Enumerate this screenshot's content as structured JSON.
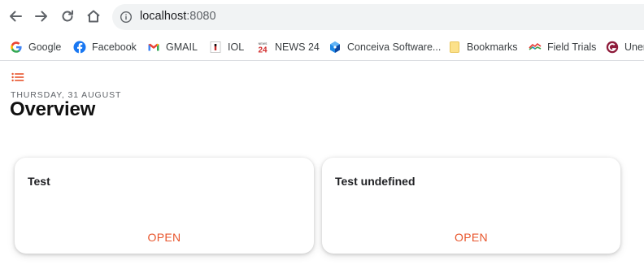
{
  "browser": {
    "url_host": "localhost",
    "url_port": ":8080",
    "bookmarks": [
      {
        "label": "Google",
        "icon": "google-icon"
      },
      {
        "label": "Facebook",
        "icon": "facebook-icon"
      },
      {
        "label": "GMAIL",
        "icon": "gmail-icon"
      },
      {
        "label": "IOL",
        "icon": "iol-icon"
      },
      {
        "label": "NEWS 24",
        "icon": "news24-icon"
      },
      {
        "label": "Conceiva Software...",
        "icon": "conceiva-icon"
      },
      {
        "label": "Bookmarks",
        "icon": "folder-icon"
      },
      {
        "label": "Field Trials",
        "icon": "field-trials-icon"
      },
      {
        "label": "Uner",
        "icon": "uner-icon"
      }
    ]
  },
  "page": {
    "date": "THURSDAY, 31 AUGUST",
    "title": "Overview",
    "accent_color": "#e8552c"
  },
  "cards": [
    {
      "title": "Test",
      "button": "OPEN"
    },
    {
      "title": "Test undefined",
      "button": "OPEN"
    }
  ]
}
